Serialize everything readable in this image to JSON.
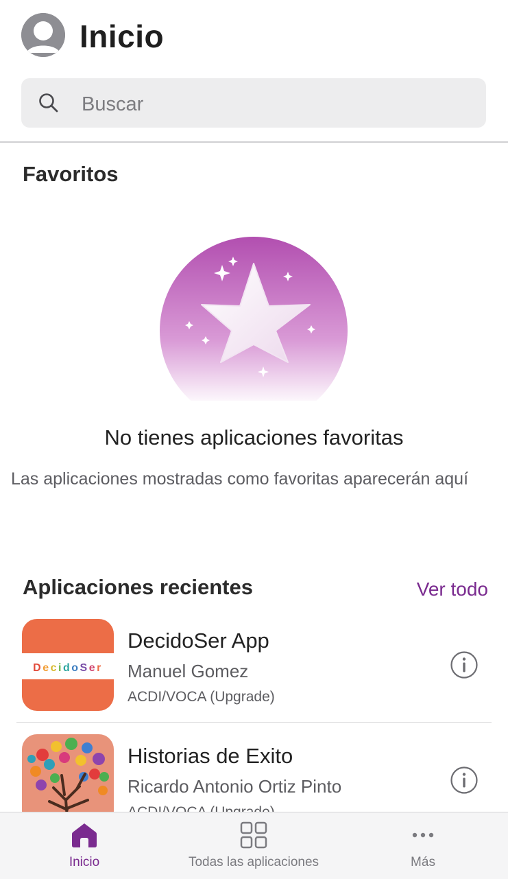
{
  "header": {
    "title": "Inicio",
    "search_placeholder": "Buscar"
  },
  "favorites": {
    "title": "Favoritos",
    "empty_title": "No tienes aplicaciones favoritas",
    "empty_subtitle": "Las aplicaciones mostradas como favoritas aparecerán aquí"
  },
  "recent": {
    "title": "Aplicaciones recientes",
    "see_all": "Ver todo",
    "apps": [
      {
        "name": "DecidoSer App",
        "author": "Manuel Gomez",
        "org": "ACDI/VOCA (Upgrade)",
        "icon_text": "DecidoSer",
        "icon_color": "#ec6d47"
      },
      {
        "name": "Historias de Exito",
        "author": "Ricardo Antonio Ortiz Pinto",
        "org": "ACDI/VOCA (Upgrade)",
        "icon_color": "#e8937a"
      }
    ]
  },
  "tabbar": {
    "items": [
      {
        "label": "Inicio",
        "icon": "home-icon",
        "active": true
      },
      {
        "label": "Todas las aplicaciones",
        "icon": "grid-icon",
        "active": false
      },
      {
        "label": "Más",
        "icon": "more-icon",
        "active": false
      }
    ]
  },
  "colors": {
    "accent": "#7a2b8f",
    "search_bg": "#ededee"
  }
}
